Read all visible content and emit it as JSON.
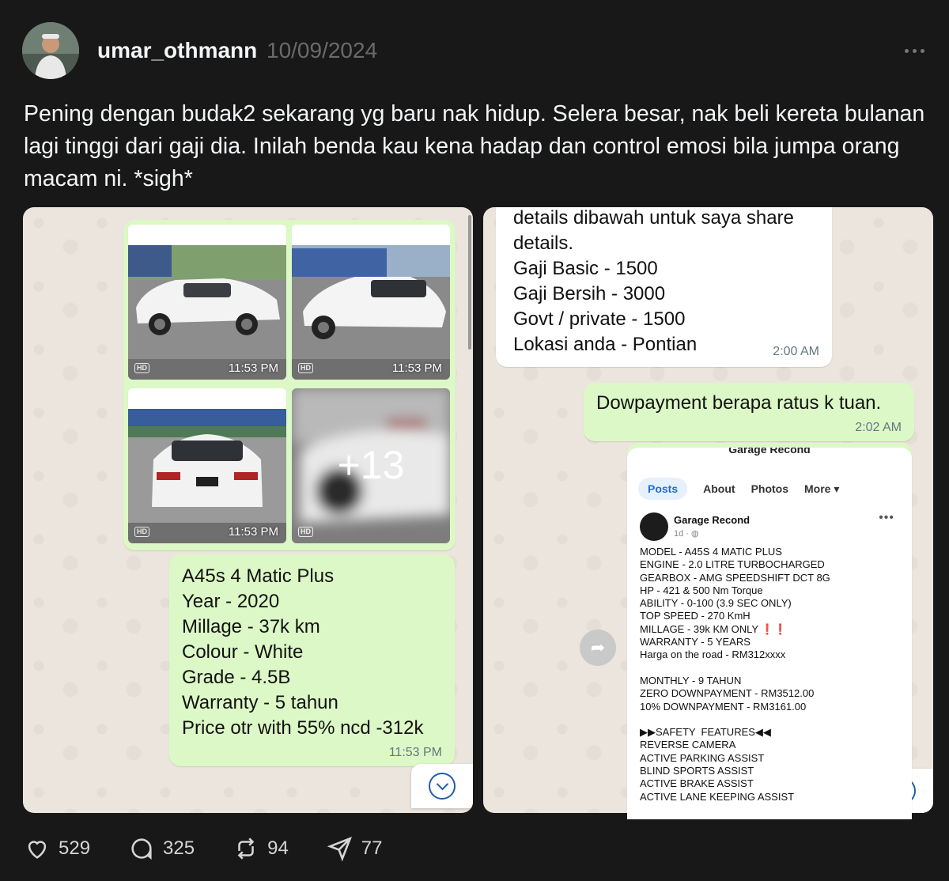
{
  "post": {
    "username": "umar_othmann",
    "date": "10/09/2024",
    "text": "Pening dengan budak2 sekarang yg baru nak hidup. Selera besar, nak beli kereta bulanan lagi tinggi dari gaji dia. Inilah benda kau kena hadap dan control emosi bila jumpa orang macam ni. *sigh*"
  },
  "left_chat": {
    "photos": [
      {
        "time": "11:53 PM",
        "badge": "HD"
      },
      {
        "time": "11:53 PM",
        "badge": "HD"
      },
      {
        "time": "11:53 PM",
        "badge": "HD"
      },
      {
        "overlay": "+13",
        "badge": "HD"
      }
    ],
    "message_lines": "A45s 4 Matic Plus\nYear - 2020\nMillage - 37k km\nColour - White\nGrade - 4.5B\nWarranty - 5 tahun\nPrice otr with 55% ncd -312k",
    "message_time": "11:53 PM"
  },
  "right_chat": {
    "incoming_lines": "details dibawah untuk saya share\ndetails.\nGaji Basic - 1500\nGaji Bersih - 3000\nGovt / private - 1500\nLokasi anda - Pontian",
    "incoming_time": "2:00 AM",
    "outgoing_text": "Dowpayment berapa ratus k tuan.",
    "outgoing_time": "2:02 AM",
    "fb_screenshot": {
      "top_title": "Garage Recond",
      "tabs": [
        "Posts",
        "About",
        "Photos",
        "More ▾"
      ],
      "page_name": "Garage Recond",
      "post_time": "1d · ◍",
      "body": "MODEL - A45S 4 MATIC PLUS\nENGINE - 2.0 LITRE TURBOCHARGED\nGEARBOX - AMG SPEEDSHIFT DCT 8G\nHP - 421 & 500 Nm Torque\nABILITY - 0-100 (3.9 SEC ONLY)\nTOP SPEED - 270 KmH\nMILLAGE - 39k KM ONLY ❗❗\nWARRANTY - 5 YEARS\nHarga on the road - RM312xxxx\n\nMONTHLY - 9 TAHUN\nZERO DOWNPAYMENT - RM3512.00\n10% DOWNPAYMENT - RM3161.00\n\n▶▶SAFETY  FEATURES◀◀\nREVERSE CAMERA\nACTIVE PARKING ASSIST\nBLIND SPORTS ASSIST\nACTIVE BRAKE ASSIST\nACTIVE LANE KEEPING ASSIST"
    }
  },
  "actions": {
    "likes": "529",
    "replies": "325",
    "reposts": "94",
    "shares": "77"
  }
}
